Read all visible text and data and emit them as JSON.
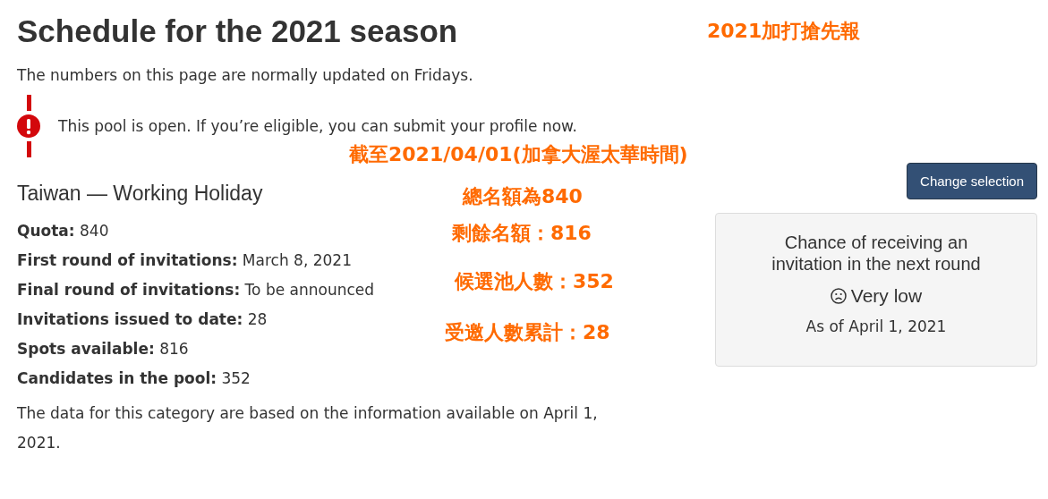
{
  "title": "Schedule for the 2021 season",
  "subtitle": "The numbers on this page are normally updated on Fridays.",
  "alert": {
    "kind": "warning",
    "text": "This pool is open. If you’re eligible, you can submit your profile now."
  },
  "category": {
    "heading": "Taiwan — Working Holiday",
    "facts": [
      {
        "label": "Quota:",
        "value": "840"
      },
      {
        "label": "First round of invitations:",
        "value": "March 8, 2021"
      },
      {
        "label": "Final round of invitations:",
        "value": "To be announced"
      },
      {
        "label": "Invitations issued to date:",
        "value": "28"
      },
      {
        "label": "Spots available:",
        "value": "816"
      },
      {
        "label": "Candidates in the pool:",
        "value": "352"
      }
    ],
    "note": "The data for this category are based on the information available on April 1, 2021."
  },
  "change_button": "Change selection",
  "chance_card": {
    "heading": "Chance of receiving an invitation in the next round",
    "rating": "Very low",
    "as_of": "As of April 1, 2021"
  },
  "annotations": [
    "2021加打搶先報",
    "截至2021/04/01(加拿大渥太華時間)",
    "總名額為840",
    "剩餘名額：816",
    "候選池人數：352",
    "受邀人數累計：28"
  ]
}
